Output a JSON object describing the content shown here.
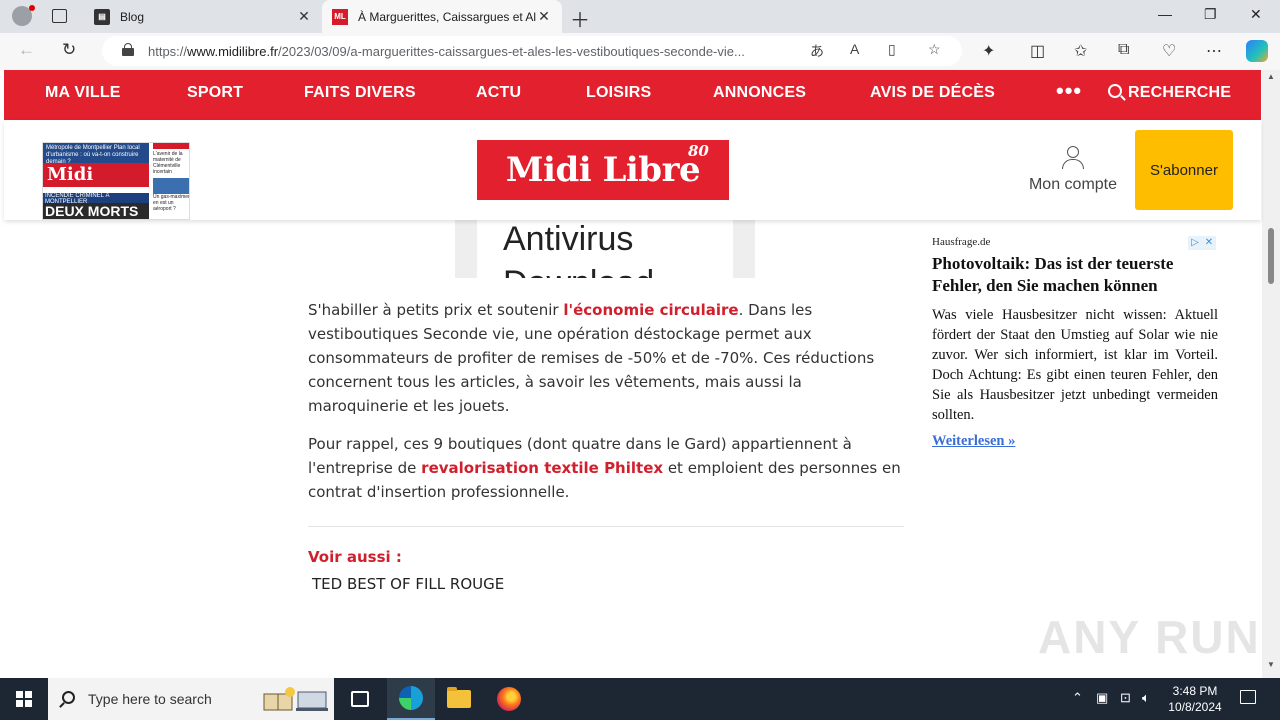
{
  "browser": {
    "tabs": [
      {
        "title": "Blog",
        "favicon": "blog-icon"
      },
      {
        "title": "À Marguerittes, Caissargues et Al",
        "favicon": "ML"
      }
    ],
    "url_prefix": "https://",
    "url_domain": "www.midilibre.fr",
    "url_path": "/2023/03/09/a-marguerittes-caissargues-et-ales-les-vestiboutiques-seconde-vie..."
  },
  "site": {
    "nav": [
      "MA VILLE",
      "SPORT",
      "FAITS DIVERS",
      "ACTU",
      "LOISIRS",
      "ANNONCES",
      "AVIS DE DÉCÈS"
    ],
    "nav_more": "•••",
    "search_label": "RECHERCHE",
    "logo": "Midi Libre",
    "logo_badge": "80",
    "account_label": "Mon compte",
    "subscribe_label": "S'abonner",
    "brand_color": "#e3202e",
    "subscribe_color": "#ffbd00",
    "paper": {
      "top_line": "Métropole de Montpellier Plan local d'urbanisme : où va-t-on construire demain ?",
      "logo": "Midi Libre",
      "blue_line": "INCENDIE CRIMINEL À MONTPELLIER",
      "headline": "DEUX MORTS",
      "side_1": "L'avenir de la maternité de Clémentville incertain",
      "side_2": "Un gas-maximer en est un aéroport ?"
    }
  },
  "ad_banner": {
    "line1": "Antivirus",
    "line2": "Download"
  },
  "article": {
    "p1_a": "S'habiller à petits prix et soutenir ",
    "p1_link": "l'économie circulaire",
    "p1_b": ". Dans les vestiboutiques Seconde vie, une opération déstockage permet aux consommateurs de profiter de remises de -50% et de -70%. Ces réductions concernent tous les articles, à savoir les vêtements, mais aussi la maroquinerie et les jouets.",
    "p2_a": "Pour rappel, ces 9 boutiques (dont quatre dans le Gard) appartiennent à l'entreprise de ",
    "p2_link": "revalorisation textile Philtex",
    "p2_b": " et emploient des personnes en contrat d'insertion professionnelle.",
    "see_also_label": "Voir aussi :",
    "see_also_item": "TED BEST OF FILL ROUGE"
  },
  "sponsored": {
    "source": "Hausfrage.de",
    "title": "Photovoltaik: Das ist der teuerste Fehler, den Sie machen können",
    "body": "Was viele Hausbesitzer nicht wissen: Aktuell fördert der Staat den Umstieg auf Solar wie nie zuvor. Wer sich informiert, ist klar im Vorteil. Doch Achtung: Es gibt einen teuren Fehler, den Sie als Hausbesitzer jetzt unbedingt vermeiden sollten.",
    "more": "Weiterlesen »"
  },
  "watermark": "ANY RUN",
  "taskbar": {
    "search_placeholder": "Type here to search",
    "time": "3:48 PM",
    "date": "10/8/2024"
  }
}
